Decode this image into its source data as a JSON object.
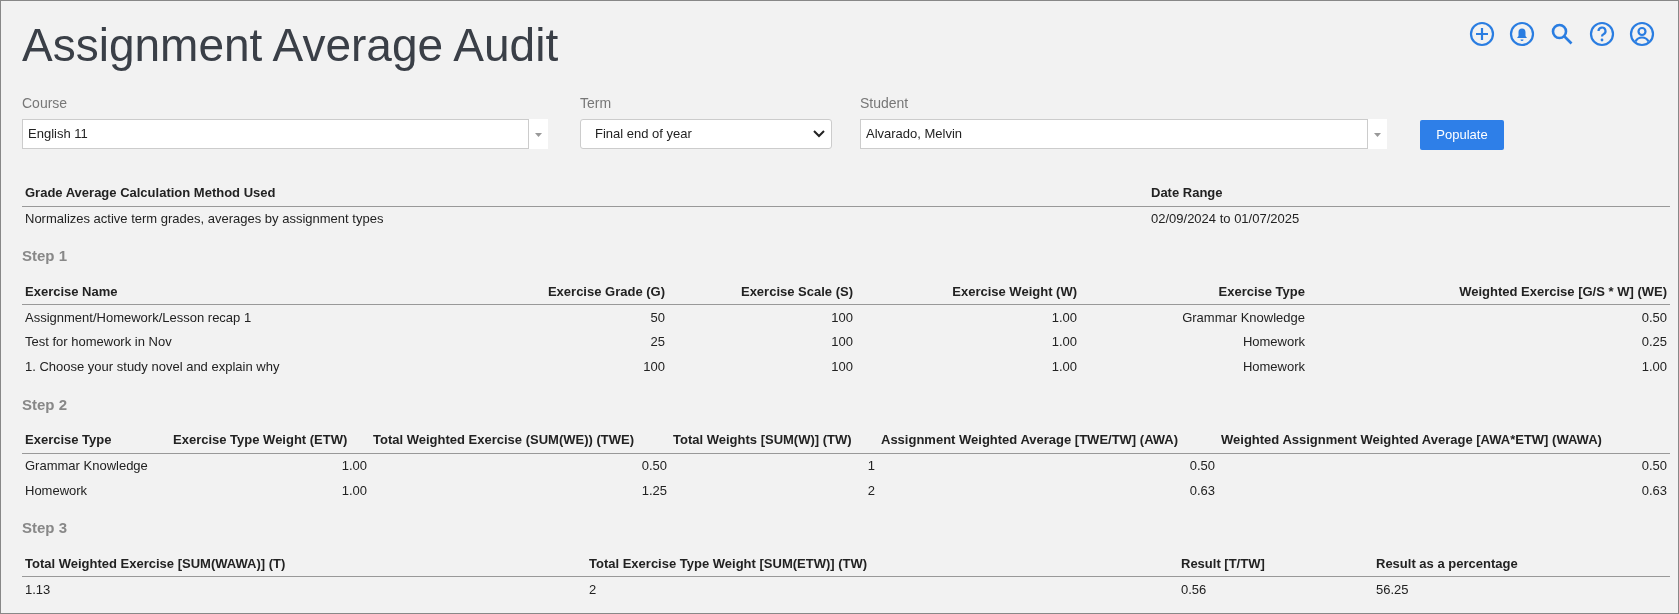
{
  "title": "Assignment Average Audit",
  "filters": {
    "course": {
      "label": "Course",
      "value": "English 11"
    },
    "term": {
      "label": "Term",
      "value": "Final end of year"
    },
    "student": {
      "label": "Student",
      "value": "Alvarado, Melvin"
    },
    "populate_button": "Populate"
  },
  "info_table": {
    "columns": [
      "Grade Average Calculation Method Used",
      "Date Range"
    ],
    "rows": [
      [
        "Normalizes active term grades, averages by assignment types",
        "02/09/2024 to 01/07/2025"
      ]
    ]
  },
  "steps": [
    {
      "title": "Step 1",
      "columns": [
        "Exercise Name",
        "Exercise Grade (G)",
        "Exercise Scale (S)",
        "Exercise Weight (W)",
        "Exercise Type",
        "Weighted Exercise [G/S * W] (WE)"
      ],
      "rows": [
        [
          "Assignment/Homework/Lesson recap 1",
          "50",
          "100",
          "1.00",
          "Grammar Knowledge",
          "0.50"
        ],
        [
          "Test for homework in Nov",
          "25",
          "100",
          "1.00",
          "Homework",
          "0.25"
        ],
        [
          "1. Choose your study novel and explain why",
          "100",
          "100",
          "1.00",
          "Homework",
          "1.00"
        ]
      ]
    },
    {
      "title": "Step 2",
      "columns": [
        "Exercise Type",
        "Exercise Type Weight (ETW)",
        "Total Weighted Exercise (SUM(WE)) (TWE)",
        "Total Weights [SUM(W)] (TW)",
        "Assignment Weighted Average [TWE/TW] (AWA)",
        "Weighted Assignment Weighted Average [AWA*ETW] (WAWA)"
      ],
      "rows": [
        [
          "Grammar Knowledge",
          "1.00",
          "0.50",
          "1",
          "0.50",
          "0.50"
        ],
        [
          "Homework",
          "1.00",
          "1.25",
          "2",
          "0.63",
          "0.63"
        ]
      ]
    },
    {
      "title": "Step 3",
      "columns": [
        "Total Weighted Exercise [SUM(WAWA)] (T)",
        "Total Exercise Type Weight [SUM(ETW)] (TW)",
        "Result [T/TW]",
        "Result as a percentage"
      ],
      "rows": [
        [
          "1.13",
          "2",
          "0.56",
          "56.25"
        ]
      ]
    }
  ]
}
